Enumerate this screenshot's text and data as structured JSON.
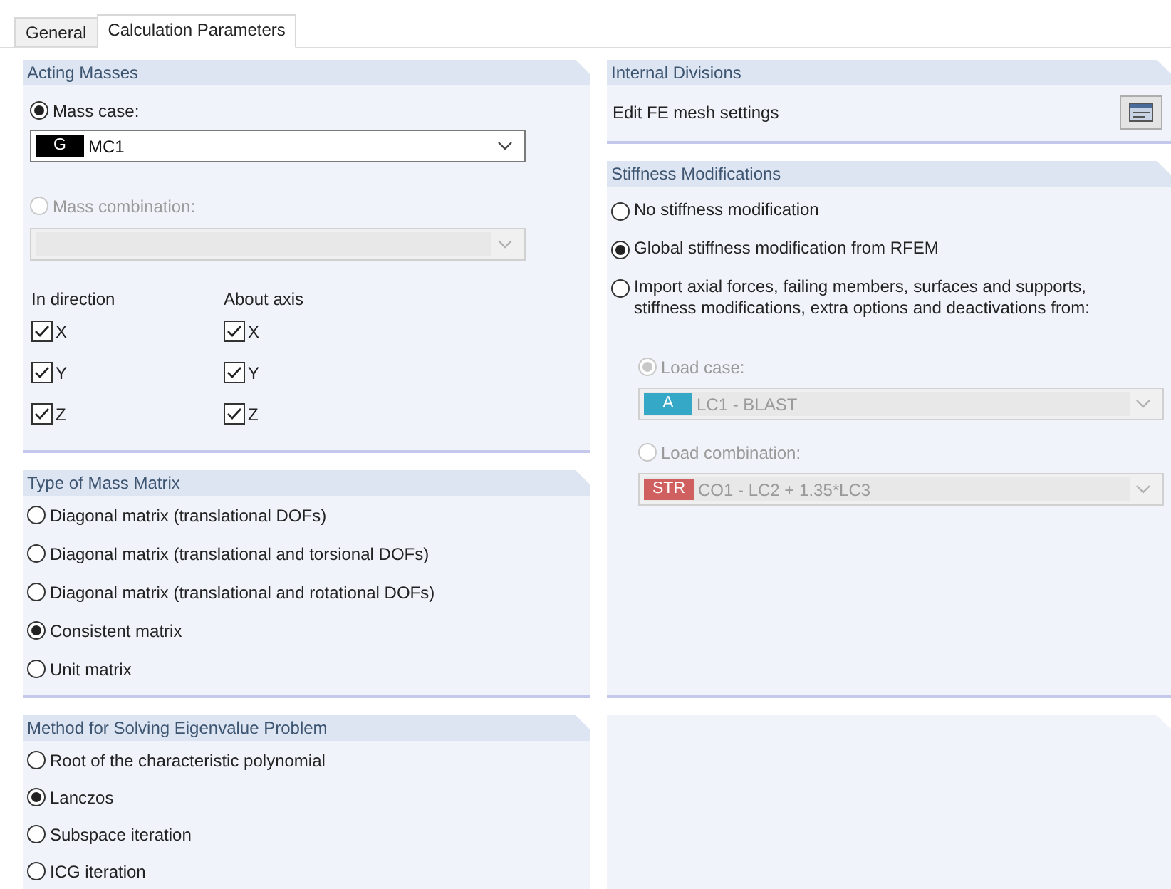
{
  "tabs": [
    {
      "label": "General",
      "selected": false
    },
    {
      "label": "Calculation Parameters",
      "selected": true
    }
  ],
  "acting_masses": {
    "title": "Acting Masses",
    "mass_case": {
      "label": "Mass case:",
      "selected": true,
      "disabled": false,
      "badge": "G",
      "color": "#000000",
      "value": "MC1"
    },
    "mass_combination": {
      "label": "Mass combination:",
      "selected": false,
      "disabled": true
    },
    "in_direction": {
      "label": "In direction",
      "items": [
        {
          "label": "X",
          "checked": true
        },
        {
          "label": "Y",
          "checked": true
        },
        {
          "label": "Z",
          "checked": true
        }
      ]
    },
    "about_axis": {
      "label": "About axis",
      "items": [
        {
          "label": "X",
          "checked": true
        },
        {
          "label": "Y",
          "checked": true
        },
        {
          "label": "Z",
          "checked": true
        }
      ]
    }
  },
  "mass_matrix": {
    "title": "Type of Mass Matrix",
    "options": [
      {
        "label": "Diagonal matrix (translational DOFs)",
        "selected": false
      },
      {
        "label": "Diagonal matrix (translational and torsional DOFs)",
        "selected": false
      },
      {
        "label": "Diagonal matrix (translational and rotational DOFs)",
        "selected": false
      },
      {
        "label": "Consistent matrix",
        "selected": true
      },
      {
        "label": "Unit matrix",
        "selected": false
      }
    ]
  },
  "eigen_method": {
    "title": "Method for Solving Eigenvalue Problem",
    "options": [
      {
        "label": "Root of the characteristic polynomial",
        "selected": false
      },
      {
        "label": "Lanczos",
        "selected": true
      },
      {
        "label": "Subspace iteration",
        "selected": false
      },
      {
        "label": "ICG iteration",
        "selected": false
      }
    ]
  },
  "internal_divisions": {
    "title": "Internal Divisions",
    "label": "Edit FE mesh settings"
  },
  "stiffness": {
    "title": "Stiffness Modifications",
    "options": [
      {
        "label": "No stiffness modification",
        "selected": false
      },
      {
        "label": "Global stiffness modification from RFEM",
        "selected": true
      },
      {
        "label": "Import axial forces, failing members, surfaces and supports, stiffness modifications, extra options and deactivations from:",
        "selected": false
      }
    ],
    "sources": [
      {
        "label": "Load case:",
        "selected": true,
        "disabled": true,
        "badge": "A",
        "color": "#35a8c8",
        "value": "LC1 - BLAST"
      },
      {
        "label": "Load combination:",
        "selected": false,
        "disabled": true,
        "badge": "STR",
        "color": "#d06060",
        "value": "CO1 - LC2 + 1.35*LC3"
      }
    ]
  }
}
